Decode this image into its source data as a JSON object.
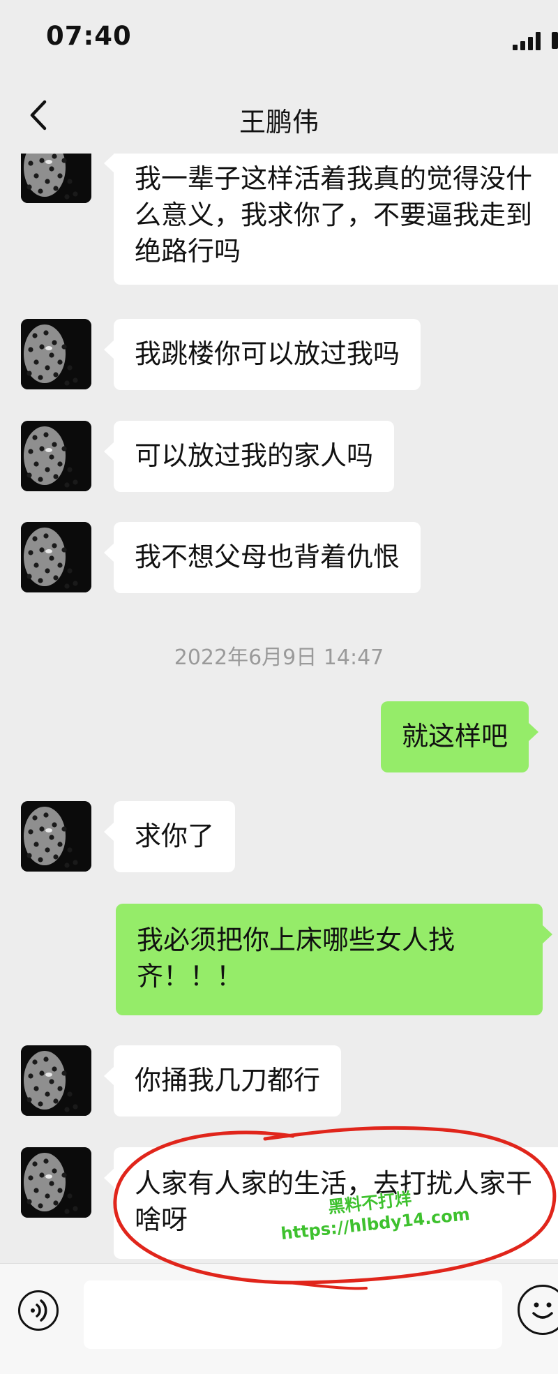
{
  "status_bar": {
    "time": "07:40"
  },
  "nav": {
    "title": "王鹏伟",
    "back_icon": "chevron-left-icon"
  },
  "timestamp": "2022年6月9日 14:47",
  "messages": [
    {
      "side": "in",
      "text": "我一辈子这样活着我真的觉得没什么意义，我求你了，不要逼我走到绝路行吗"
    },
    {
      "side": "in",
      "text": "我跳楼你可以放过我吗"
    },
    {
      "side": "in",
      "text": "可以放过我的家人吗"
    },
    {
      "side": "in",
      "text": "我不想父母也背着仇恨"
    },
    {
      "side": "out",
      "text": "就这样吧"
    },
    {
      "side": "in",
      "text": "求你了"
    },
    {
      "side": "out",
      "text": "我必须把你上床哪些女人找齐！！！"
    },
    {
      "side": "in",
      "text": "你捅我几刀都行"
    },
    {
      "side": "in",
      "text": "人家有人家的生活，去打扰人家干啥呀"
    }
  ],
  "watermark": {
    "line1": "黑料不打烊",
    "line2": "https://hlbdy14.com"
  },
  "input_bar": {
    "voice_icon": "voice-icon",
    "emoji_icon": "emoji-icon",
    "input_placeholder": ""
  },
  "colors": {
    "background": "#ededed",
    "incoming_bubble": "#ffffff",
    "outgoing_bubble": "#95ec69",
    "annotation_circle": "#e0251b"
  }
}
